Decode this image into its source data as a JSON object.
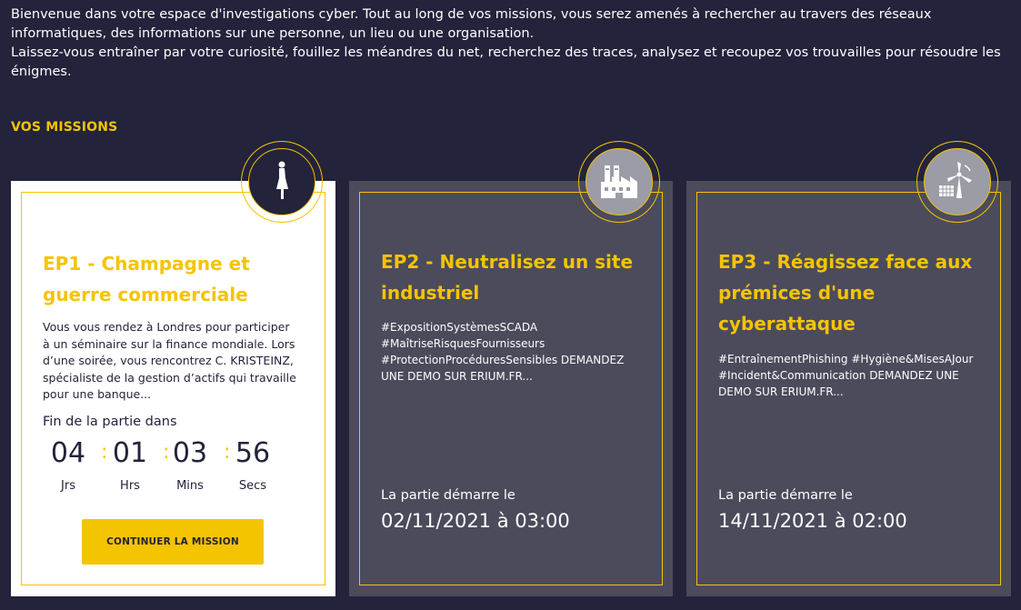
{
  "intro": {
    "line1": "Bienvenue dans votre espace d'investigations cyber. Tout au long de vos missions, vous serez amenés à rechercher au travers des réseaux informatiques, des informations sur une personne, un lieu ou une organisation.",
    "line2": "Laissez-vous entraîner par votre curiosité, fouillez les méandres du net, recherchez des traces, analysez et recoupez vos trouvailles pour résoudre les énigmes."
  },
  "section_title": "VOS MISSIONS",
  "colors": {
    "accent": "#f5c400",
    "background": "#23233c",
    "card_dark": "#4b4b5c"
  },
  "missions": [
    {
      "icon": "woman-silhouette-icon",
      "title": "EP1 - Champagne et guerre commerciale",
      "description": "Vous vous rendez à Londres pour participer à un séminaire sur la finance mondiale. Lors d’une soirée, vous rencontrez C. KRISTEINZ, spécialiste de la gestion d’actifs qui travaille pour une banque...",
      "timer_label": "Fin de la partie dans",
      "countdown": [
        {
          "value": "04",
          "unit": "Jrs"
        },
        {
          "value": "01",
          "unit": "Hrs"
        },
        {
          "value": "03",
          "unit": "Mins"
        },
        {
          "value": "56",
          "unit": "Secs"
        }
      ],
      "cta": "CONTINUER LA MISSION"
    },
    {
      "icon": "factory-icon",
      "title": "EP2 - Neutralisez un site industriel",
      "tags": "#ExpositionSystèmesSCADA #MaîtriseRisquesFournisseurs #ProtectionProcéduresSensibles  DEMANDEZ UNE DEMO SUR ERIUM.FR...",
      "start_label": "La partie démarre le",
      "start_date": "02/11/2021 à 03:00"
    },
    {
      "icon": "wind-turbine-solar-icon",
      "title": "EP3 - Réagissez face aux prémices d'une cyberattaque",
      "tags": "#EntraînementPhishing #Hygiène&MisesAJour #Incident&Communication  DEMANDEZ UNE DEMO SUR ERIUM.FR...",
      "start_label": "La partie démarre le",
      "start_date": "14/11/2021 à 02:00"
    }
  ]
}
